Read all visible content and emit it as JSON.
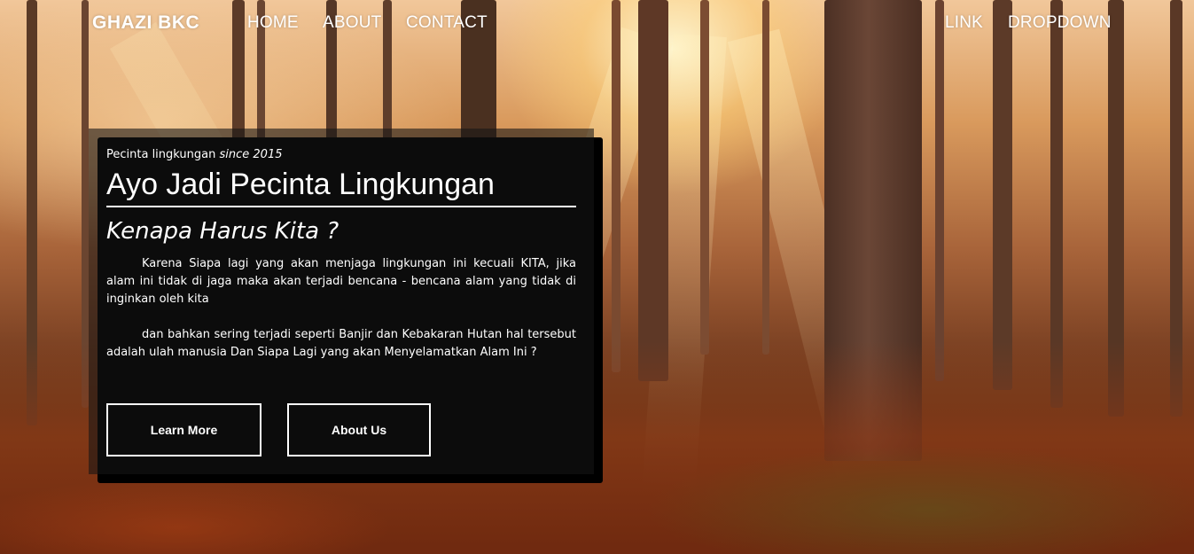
{
  "nav": {
    "brand": "GHAZI BKC",
    "links": [
      "HOME",
      "ABOUT",
      "CONTACT"
    ],
    "right_links": [
      "LINK",
      "DROPDOWN"
    ]
  },
  "hero": {
    "kicker_prefix": "Pecinta lingkungan",
    "kicker_since": "since 2015",
    "title": "Ayo Jadi Pecinta Lingkungan",
    "subtitle": "Kenapa Harus Kita ?",
    "paragraphs": [
      "Karena Siapa lagi yang akan menjaga lingkungan ini kecuali KITA, jika alam ini tidak di jaga maka akan terjadi bencana - bencana alam yang tidak di inginkan oleh kita",
      "dan bahkan sering terjadi seperti Banjir dan Kebakaran Hutan hal tersebut adalah ulah manusia Dan Siapa Lagi yang akan Menyelamatkan Alam Ini ?"
    ],
    "buttons": {
      "learn_more": "Learn More",
      "about_us": "About Us"
    }
  },
  "colors": {
    "text": "#ffffff",
    "card_overlay": "rgba(20,20,20,0.58)",
    "card_shadow": "#000000"
  }
}
